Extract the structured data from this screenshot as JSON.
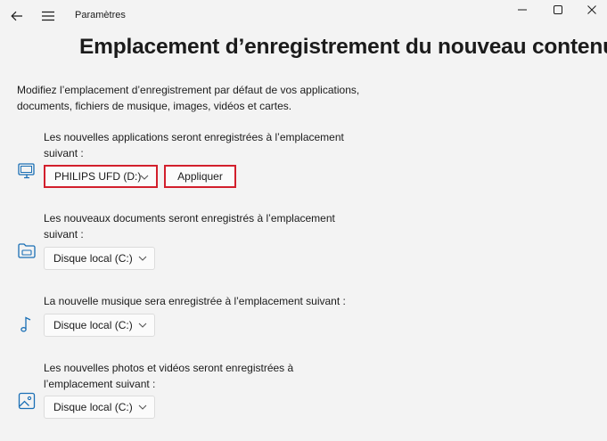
{
  "window": {
    "title": "Paramètres",
    "back_icon": "back-arrow-icon",
    "menu_icon": "hamburger-menu-icon",
    "controls": [
      "minimize-icon",
      "maximize-icon",
      "close-icon"
    ]
  },
  "page": {
    "title": "Emplacement d’enregistrement du nouveau contenu",
    "intro": "Modifiez l’emplacement d’enregistrement par défaut de vos applications, documents, fichiers de musique, images, vidéos et cartes."
  },
  "sections": [
    {
      "label": "Les nouvelles applications seront enregistrées à l’emplacement suivant :",
      "icon": "computer-monitor-icon",
      "selected": "PHILIPS UFD (D:)",
      "apply_label": "Appliquer",
      "highlighted": true
    },
    {
      "label": "Les nouveaux documents seront enregistrés à l’emplacement suivant :",
      "icon": "folder-drive-icon",
      "selected": "Disque local (C:)"
    },
    {
      "label": "La nouvelle musique sera enregistrée à l’emplacement suivant :",
      "icon": "music-note-icon",
      "selected": "Disque local (C:)"
    },
    {
      "label": "Les nouvelles photos et vidéos seront enregistrées à l’emplacement suivant :",
      "icon": "picture-icon",
      "selected": "Disque local (C:)"
    }
  ],
  "colors": {
    "background": "#f3f3f3",
    "highlight_border": "#d21f2c",
    "icon_blue": "#1a6fb5"
  }
}
